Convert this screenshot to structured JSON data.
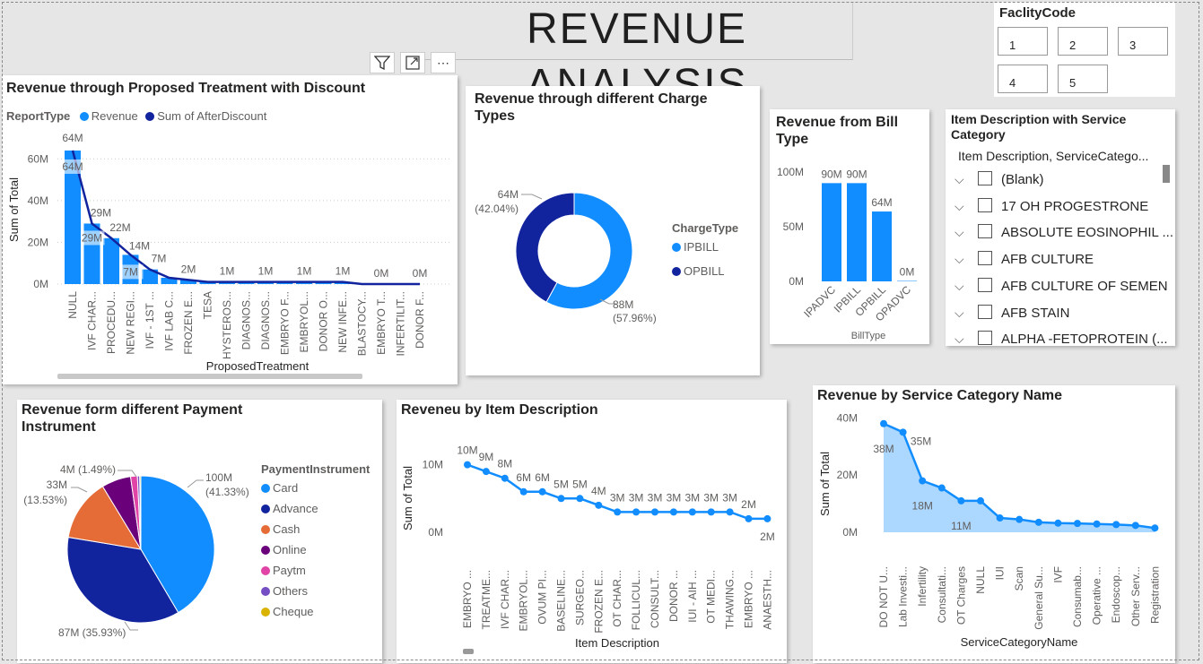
{
  "page": {
    "title": "REVENUE ANALYSIS"
  },
  "header_icons": {
    "filter": "filter-icon",
    "focus": "focus-mode-icon",
    "more": "more-options-icon"
  },
  "facility": {
    "title": "FaclityCode",
    "codes": [
      "1",
      "2",
      "3",
      "4",
      "5"
    ]
  },
  "proposed": {
    "title": "Revenue through Proposed Treatment with Discount",
    "legend_title": "ReportType",
    "ylabel": "Sum of Total",
    "xlabel": "ProposedTreatment",
    "yticks": [
      "0M",
      "20M",
      "40M",
      "60M"
    ]
  },
  "charge": {
    "title": "Revenue through different Charge Types",
    "legend_title": "ChargeType"
  },
  "bill": {
    "title": "Revenue from Bill Type",
    "xlabel": "BillType",
    "yticks": [
      "0M",
      "50M",
      "100M"
    ]
  },
  "slicer": {
    "title": "Item Description with Service Category",
    "header": "Item Description, ServiceCatego...",
    "items": [
      "(Blank)",
      "17 OH PROGESTRONE",
      "ABSOLUTE EOSINOPHIL ...",
      "AFB CULTURE",
      "AFB CULTURE OF SEMEN",
      "AFB STAIN",
      "ALPHA -FETOPROTEIN (..."
    ]
  },
  "payment": {
    "title": "Revenue form different Payment Instrument",
    "legend_title": "PaymentInstrument"
  },
  "item": {
    "title": "Reveneu by Item Description",
    "ylabel": "Sum of Total",
    "xlabel": "Item Description",
    "yticks": [
      "0M",
      "10M"
    ]
  },
  "service": {
    "title": "Revenue by Service Category Name",
    "ylabel": "Sum of Total",
    "xlabel": "ServiceCategoryName",
    "yticks": [
      "0M",
      "20M",
      "40M"
    ]
  },
  "colors": {
    "light_blue": "#118DFF",
    "dark_blue": "#12239E",
    "orange": "#E66C37",
    "purple": "#6B007B",
    "pink": "#E044A7",
    "violet": "#744EC2",
    "yellow": "#D9B300"
  },
  "chart_data": [
    {
      "type": "bar",
      "title": "Revenue through Proposed Treatment with Discount",
      "xlabel": "ProposedTreatment",
      "ylabel": "Sum of Total",
      "ylim": [
        0,
        70
      ],
      "categories": [
        "NULL",
        "IVF CHAR...",
        "PROCEDU...",
        "NEW REGI...",
        "IVF - 1ST ...",
        "IVF LAB C...",
        "FROZEN E...",
        "TESA",
        "HYSTEROS...",
        "DIAGNOS...",
        "DIAGNOS...",
        "EMBRYO F...",
        "EMBRYOL...",
        "DONOR O...",
        "NEW INFE...",
        "BLASTOCY...",
        "EMBRYO T...",
        "INFERTILIT...",
        "DONOR F..."
      ],
      "series": [
        {
          "name": "Revenue",
          "values": [
            64,
            29,
            22,
            14,
            7,
            3,
            2,
            1,
            1,
            1,
            1,
            1,
            1,
            1,
            1,
            0,
            0,
            0,
            0
          ]
        },
        {
          "name": "Sum of AfterDiscount",
          "values": [
            64,
            29,
            22,
            14,
            7,
            3,
            2,
            1,
            1,
            1,
            1,
            1,
            1,
            1,
            1,
            0,
            0,
            0,
            0
          ]
        }
      ],
      "data_labels": [
        {
          "i": 0,
          "text": "64M",
          "series": "Revenue"
        },
        {
          "i": 0,
          "text": "64M",
          "series": "Sum of AfterDiscount"
        },
        {
          "i": 1,
          "text": "29M",
          "series": "Revenue"
        },
        {
          "i": 1,
          "text": "29M",
          "series": "Sum of AfterDiscount"
        },
        {
          "i": 2,
          "text": "22M",
          "series": "Revenue"
        },
        {
          "i": 3,
          "text": "14M",
          "series": "Revenue"
        },
        {
          "i": 3,
          "text": "7M",
          "series": "Sum of AfterDiscount"
        },
        {
          "i": 4,
          "text": "7M",
          "series": "Revenue"
        },
        {
          "i": 6,
          "text": "2M",
          "series": "Revenue"
        },
        {
          "i": 8,
          "text": "1M",
          "series": "Revenue"
        },
        {
          "i": 10,
          "text": "1M",
          "series": "Revenue"
        },
        {
          "i": 12,
          "text": "1M",
          "series": "Revenue"
        },
        {
          "i": 14,
          "text": "1M",
          "series": "Revenue"
        },
        {
          "i": 16,
          "text": "0M",
          "series": "Revenue"
        },
        {
          "i": 18,
          "text": "0M",
          "series": "Revenue"
        }
      ]
    },
    {
      "type": "pie",
      "title": "Revenue through different Charge Types",
      "slices": [
        {
          "name": "IPBILL",
          "value": 88,
          "label": "88M",
          "pct": "(57.96%)"
        },
        {
          "name": "OPBILL",
          "value": 64,
          "label": "64M",
          "pct": "(42.04%)"
        }
      ]
    },
    {
      "type": "bar",
      "title": "Revenue from Bill Type",
      "xlabel": "BillType",
      "ylim": [
        0,
        110
      ],
      "categories": [
        "IPADVC",
        "IPBILL",
        "OPBILL",
        "OPADVC"
      ],
      "values": [
        90,
        90,
        64,
        0.4
      ],
      "value_labels": [
        "90M",
        "90M",
        "64M",
        "0M"
      ]
    },
    {
      "type": "pie",
      "title": "Revenue form different Payment Instrument",
      "slices": [
        {
          "name": "Card",
          "value": 100,
          "label": "100M",
          "pct": "(41.33%)"
        },
        {
          "name": "Advance",
          "value": 87,
          "label": "87M",
          "pct": "(35.93%)"
        },
        {
          "name": "Cash",
          "value": 33,
          "label": "33M",
          "pct": "(13.53%)"
        },
        {
          "name": "Online",
          "value": 15.5,
          "label": "",
          "pct": ""
        },
        {
          "name": "Paytm",
          "value": 3.6,
          "label": "4M",
          "pct": "(1.49%)"
        },
        {
          "name": "Others",
          "value": 1.2,
          "label": "",
          "pct": ""
        },
        {
          "name": "Cheque",
          "value": 0.6,
          "label": "",
          "pct": ""
        }
      ]
    },
    {
      "type": "line",
      "title": "Reveneu by Item Description",
      "xlabel": "Item Description",
      "ylabel": "Sum of Total",
      "ylim": [
        0,
        13
      ],
      "categories": [
        "EMBRYO ...",
        "TREATME...",
        "IVF CHAR...",
        "EMBRYOL...",
        "OVUM PI...",
        "BASELINE...",
        "SURGEO...",
        "FROZEN E...",
        "OT CHAR...",
        "FOLLICUL...",
        "CONSULT...",
        "DONOR ...",
        "IUI - AIH ...",
        "OT MEDI...",
        "THAWING...",
        "EMBRYO ...",
        "ANAESTH..."
      ],
      "values": [
        10,
        9,
        8,
        6,
        6,
        5,
        5,
        4,
        3,
        3,
        3,
        3,
        3,
        3,
        3,
        2,
        2
      ],
      "value_labels": [
        "10M",
        "9M",
        "8M",
        "6M",
        "6M",
        "5M",
        "5M",
        "4M",
        "3M",
        "3M",
        "3M",
        "3M",
        "3M",
        "3M",
        "3M",
        "2M",
        "2M"
      ]
    },
    {
      "type": "area",
      "title": "Revenue by Service Category Name",
      "xlabel": "ServiceCategoryName",
      "ylabel": "Sum of Total",
      "ylim": [
        0,
        42
      ],
      "categories": [
        "DO NOT U...",
        "Lab Investi...",
        "Infertility",
        "Consultati...",
        "OT Charges",
        "NULL",
        "IUI",
        "Scan",
        "General Su...",
        "IVF",
        "Consumab...",
        "Operative ...",
        "Endoscop...",
        "Other Serv...",
        "Registration"
      ],
      "values": [
        38,
        35,
        18,
        15.5,
        11,
        11,
        5,
        4.5,
        3.5,
        3.2,
        3.1,
        2.9,
        2.7,
        2.4,
        1.5
      ],
      "data_labels": [
        {
          "i": 0,
          "text": "38M"
        },
        {
          "i": 1,
          "text": "35M"
        },
        {
          "i": 2,
          "text": "18M"
        },
        {
          "i": 4,
          "text": "11M"
        }
      ]
    }
  ]
}
